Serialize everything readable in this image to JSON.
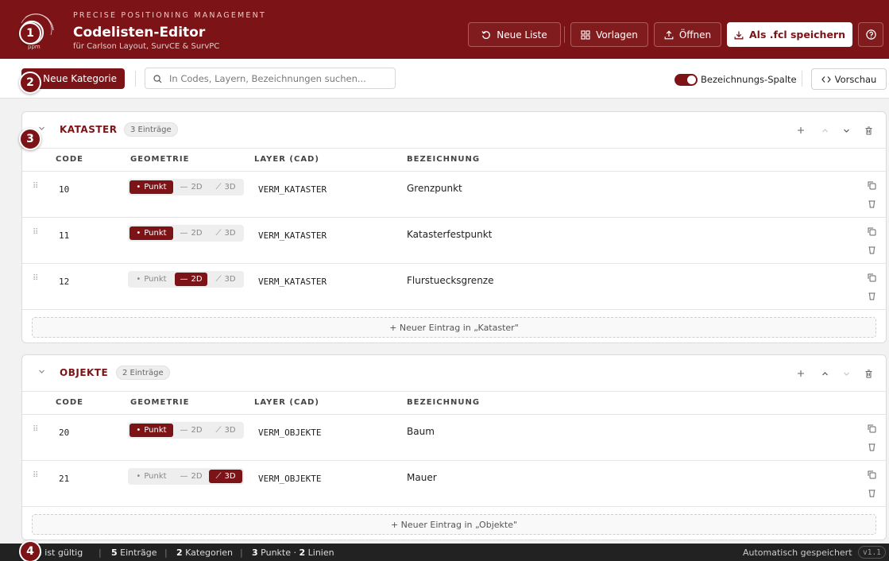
{
  "header": {
    "subtitle": "PRECISE POSITIONING MANAGEMENT",
    "title": "Codelisten-Editor",
    "tagline": "für Carlson Layout, SurvCE & SurvPC",
    "logo_text": "ppm",
    "buttons": {
      "new_list": "Neue Liste",
      "templates": "Vorlagen",
      "open": "Öffnen",
      "save": "Als .fcl speichern"
    }
  },
  "toolbar": {
    "new_category": "Neue Kategorie",
    "search_placeholder": "In Codes, Layern, Bezeichnungen suchen...",
    "toggle_label": "Bezeichnungs-Spalte",
    "preview": "Vorschau"
  },
  "columns": {
    "code": "CODE",
    "geometry": "GEOMETRIE",
    "layer": "LAYER (CAD)",
    "label": "BEZEICHNUNG"
  },
  "geometry_options": {
    "point": "Punkt",
    "line2d": "2D",
    "line3d": "3D"
  },
  "categories": [
    {
      "name": "KATASTER",
      "count": "3 Einträge",
      "add_label": "+ Neuer Eintrag in „Kataster\"",
      "rows": [
        {
          "code": "10",
          "geometry": "point",
          "layer": "VERM_KATASTER",
          "label": "Grenzpunkt"
        },
        {
          "code": "11",
          "geometry": "point",
          "layer": "VERM_KATASTER",
          "label": "Katasterfestpunkt"
        },
        {
          "code": "12",
          "geometry": "line2d",
          "layer": "VERM_KATASTER",
          "label": "Flurstuecksgrenze"
        }
      ]
    },
    {
      "name": "OBJEKTE",
      "count": "2 Einträge",
      "add_label": "+ Neuer Eintrag in „Objekte\"",
      "rows": [
        {
          "code": "20",
          "geometry": "point",
          "layer": "VERM_OBJEKTE",
          "label": "Baum"
        },
        {
          "code": "21",
          "geometry": "line3d",
          "layer": "VERM_OBJEKTE",
          "label": "Mauer"
        }
      ]
    }
  ],
  "footer": {
    "status": "e ist gültig",
    "entries_num": "5",
    "entries_lbl": " Einträge",
    "categories_num": "2",
    "categories_lbl": " Kategorien",
    "points_num": "3",
    "points_lbl": " Punkte · ",
    "lines_num": "2",
    "lines_lbl": " Linien",
    "autosave": "Automatisch gespeichert",
    "version": "v1.1"
  },
  "badges": [
    "1",
    "2",
    "3",
    "4"
  ],
  "colors": {
    "accent": "#7c1417",
    "footer": "#222222",
    "page": "#f3f2f2"
  }
}
